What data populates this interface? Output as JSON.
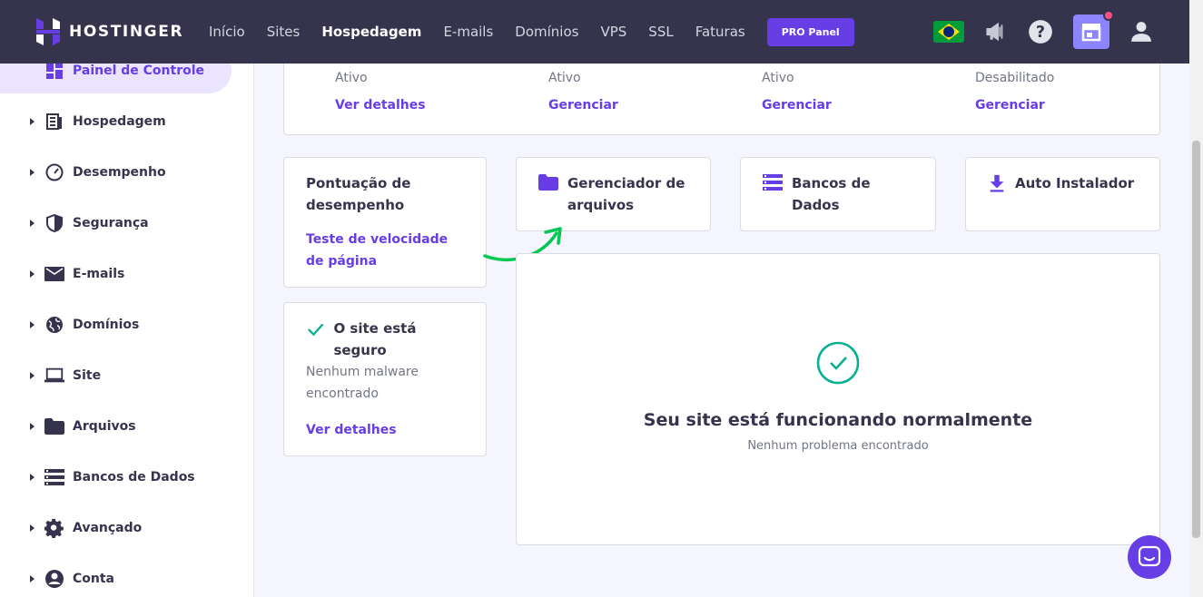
{
  "brand": {
    "name": "HOSTINGER"
  },
  "nav": {
    "items": [
      "Início",
      "Sites",
      "Hospedagem",
      "E-mails",
      "Domínios",
      "VPS",
      "SSL",
      "Faturas"
    ],
    "active": "Hospedagem",
    "pro_label": "PRO Panel"
  },
  "sidebar": {
    "items": [
      {
        "label": "Painel de Controle",
        "icon": "dashboard-icon"
      },
      {
        "label": "Hospedagem",
        "icon": "server-icon"
      },
      {
        "label": "Desempenho",
        "icon": "gauge-icon"
      },
      {
        "label": "Segurança",
        "icon": "shield-icon"
      },
      {
        "label": "E-mails",
        "icon": "mail-icon"
      },
      {
        "label": "Domínios",
        "icon": "globe-icon"
      },
      {
        "label": "Site",
        "icon": "laptop-icon"
      },
      {
        "label": "Arquivos",
        "icon": "folder-icon"
      },
      {
        "label": "Bancos de Dados",
        "icon": "database-icon"
      },
      {
        "label": "Avançado",
        "icon": "gear-icon"
      },
      {
        "label": "Conta",
        "icon": "account-icon"
      }
    ]
  },
  "status": [
    {
      "state": "Ativo",
      "link": "Ver detalhes"
    },
    {
      "state": "Ativo",
      "link": "Gerenciar"
    },
    {
      "state": "Ativo",
      "link": "Gerenciar"
    },
    {
      "state": "Desabilitado",
      "link": "Gerenciar"
    }
  ],
  "performance": {
    "title": "Pontuação de desempenho",
    "link": "Teste de velocidade de página"
  },
  "tools": [
    {
      "label": "Gerenciador de arquivos",
      "icon": "folder-icon"
    },
    {
      "label": "Bancos de Dados",
      "icon": "database-icon"
    },
    {
      "label": "Auto Instalador",
      "icon": "download-icon"
    }
  ],
  "security": {
    "title": "O site está seguro",
    "desc": "Nenhum malware encontrado",
    "link": "Ver detalhes"
  },
  "health": {
    "title": "Seu site está funcionando normalmente",
    "subtitle": "Nenhum problema encontrado"
  },
  "colors": {
    "primary": "#673de6",
    "topbar": "#36344d",
    "success": "#00b090",
    "annotation": "#00c853"
  }
}
